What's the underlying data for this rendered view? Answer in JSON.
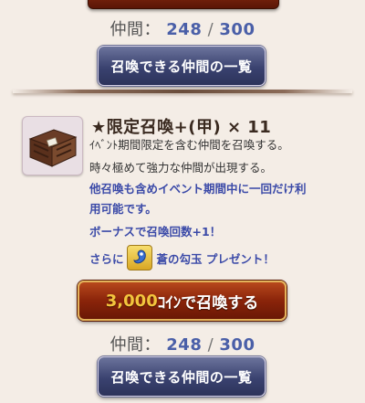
{
  "top_section": {
    "count_label": "仲間：",
    "count_current": "248",
    "count_separator": "/",
    "count_max": "300",
    "list_button_label": "召喚できる仲間の一覧"
  },
  "gacha": {
    "title": "★限定召喚+(甲) × 11",
    "desc_line1": "ｲﾍﾞﾝﾄ期間限定を含む仲間を召喚する。",
    "desc_line2": "時々極めて強力な仲間が出現する。",
    "notice_line1": "他召喚も含めイベント期間中に一回だけ利",
    "notice_line2": "用可能です。",
    "bonus_line": "ボーナスで召喚回数+1！",
    "present_prefix": "さらに",
    "present_item": "蒼の勾玉 プレゼント！",
    "present_icon": "magatama-icon",
    "cta_price": "3,000",
    "cta_label": "ｺｲﾝで召喚する",
    "count_label": "仲間：",
    "count_current": "248",
    "count_separator": "/",
    "count_max": "300",
    "list_button_label": "召喚できる仲間の一覧"
  },
  "colors": {
    "background": "#f4ede6",
    "count_number": "#4a5fa8",
    "notice_text": "#3b4aa8",
    "cta_price": "#f3c53d"
  }
}
